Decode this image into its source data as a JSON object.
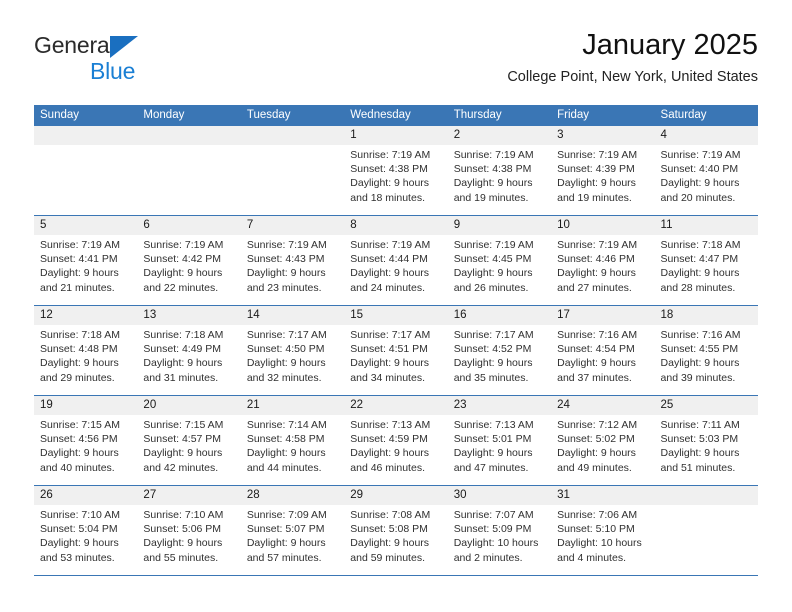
{
  "brand": {
    "name_top": "General",
    "name_bottom": "Blue",
    "accent_color": "#1a7fd4",
    "triangle_color": "#1a6fc0"
  },
  "header": {
    "title": "January 2025",
    "subtitle": "College Point, New York, United States"
  },
  "theme": {
    "header_bar_color": "#3a76b5",
    "day_band_color": "#f0f0f0",
    "row_rule_color": "#3a76b5"
  },
  "weekdays": [
    "Sunday",
    "Monday",
    "Tuesday",
    "Wednesday",
    "Thursday",
    "Friday",
    "Saturday"
  ],
  "labels": {
    "sunrise_prefix": "Sunrise:",
    "sunset_prefix": "Sunset:",
    "daylight_prefix": "Daylight:"
  },
  "weeks": [
    [
      {
        "day": "",
        "sunrise": "",
        "sunset": "",
        "daylight_line1": "",
        "daylight_line2": "",
        "empty": true
      },
      {
        "day": "",
        "sunrise": "",
        "sunset": "",
        "daylight_line1": "",
        "daylight_line2": "",
        "empty": true
      },
      {
        "day": "",
        "sunrise": "",
        "sunset": "",
        "daylight_line1": "",
        "daylight_line2": "",
        "empty": true
      },
      {
        "day": "1",
        "sunrise": "Sunrise: 7:19 AM",
        "sunset": "Sunset: 4:38 PM",
        "daylight_line1": "Daylight: 9 hours",
        "daylight_line2": "and 18 minutes.",
        "empty": false
      },
      {
        "day": "2",
        "sunrise": "Sunrise: 7:19 AM",
        "sunset": "Sunset: 4:38 PM",
        "daylight_line1": "Daylight: 9 hours",
        "daylight_line2": "and 19 minutes.",
        "empty": false
      },
      {
        "day": "3",
        "sunrise": "Sunrise: 7:19 AM",
        "sunset": "Sunset: 4:39 PM",
        "daylight_line1": "Daylight: 9 hours",
        "daylight_line2": "and 19 minutes.",
        "empty": false
      },
      {
        "day": "4",
        "sunrise": "Sunrise: 7:19 AM",
        "sunset": "Sunset: 4:40 PM",
        "daylight_line1": "Daylight: 9 hours",
        "daylight_line2": "and 20 minutes.",
        "empty": false
      }
    ],
    [
      {
        "day": "5",
        "sunrise": "Sunrise: 7:19 AM",
        "sunset": "Sunset: 4:41 PM",
        "daylight_line1": "Daylight: 9 hours",
        "daylight_line2": "and 21 minutes.",
        "empty": false
      },
      {
        "day": "6",
        "sunrise": "Sunrise: 7:19 AM",
        "sunset": "Sunset: 4:42 PM",
        "daylight_line1": "Daylight: 9 hours",
        "daylight_line2": "and 22 minutes.",
        "empty": false
      },
      {
        "day": "7",
        "sunrise": "Sunrise: 7:19 AM",
        "sunset": "Sunset: 4:43 PM",
        "daylight_line1": "Daylight: 9 hours",
        "daylight_line2": "and 23 minutes.",
        "empty": false
      },
      {
        "day": "8",
        "sunrise": "Sunrise: 7:19 AM",
        "sunset": "Sunset: 4:44 PM",
        "daylight_line1": "Daylight: 9 hours",
        "daylight_line2": "and 24 minutes.",
        "empty": false
      },
      {
        "day": "9",
        "sunrise": "Sunrise: 7:19 AM",
        "sunset": "Sunset: 4:45 PM",
        "daylight_line1": "Daylight: 9 hours",
        "daylight_line2": "and 26 minutes.",
        "empty": false
      },
      {
        "day": "10",
        "sunrise": "Sunrise: 7:19 AM",
        "sunset": "Sunset: 4:46 PM",
        "daylight_line1": "Daylight: 9 hours",
        "daylight_line2": "and 27 minutes.",
        "empty": false
      },
      {
        "day": "11",
        "sunrise": "Sunrise: 7:18 AM",
        "sunset": "Sunset: 4:47 PM",
        "daylight_line1": "Daylight: 9 hours",
        "daylight_line2": "and 28 minutes.",
        "empty": false
      }
    ],
    [
      {
        "day": "12",
        "sunrise": "Sunrise: 7:18 AM",
        "sunset": "Sunset: 4:48 PM",
        "daylight_line1": "Daylight: 9 hours",
        "daylight_line2": "and 29 minutes.",
        "empty": false
      },
      {
        "day": "13",
        "sunrise": "Sunrise: 7:18 AM",
        "sunset": "Sunset: 4:49 PM",
        "daylight_line1": "Daylight: 9 hours",
        "daylight_line2": "and 31 minutes.",
        "empty": false
      },
      {
        "day": "14",
        "sunrise": "Sunrise: 7:17 AM",
        "sunset": "Sunset: 4:50 PM",
        "daylight_line1": "Daylight: 9 hours",
        "daylight_line2": "and 32 minutes.",
        "empty": false
      },
      {
        "day": "15",
        "sunrise": "Sunrise: 7:17 AM",
        "sunset": "Sunset: 4:51 PM",
        "daylight_line1": "Daylight: 9 hours",
        "daylight_line2": "and 34 minutes.",
        "empty": false
      },
      {
        "day": "16",
        "sunrise": "Sunrise: 7:17 AM",
        "sunset": "Sunset: 4:52 PM",
        "daylight_line1": "Daylight: 9 hours",
        "daylight_line2": "and 35 minutes.",
        "empty": false
      },
      {
        "day": "17",
        "sunrise": "Sunrise: 7:16 AM",
        "sunset": "Sunset: 4:54 PM",
        "daylight_line1": "Daylight: 9 hours",
        "daylight_line2": "and 37 minutes.",
        "empty": false
      },
      {
        "day": "18",
        "sunrise": "Sunrise: 7:16 AM",
        "sunset": "Sunset: 4:55 PM",
        "daylight_line1": "Daylight: 9 hours",
        "daylight_line2": "and 39 minutes.",
        "empty": false
      }
    ],
    [
      {
        "day": "19",
        "sunrise": "Sunrise: 7:15 AM",
        "sunset": "Sunset: 4:56 PM",
        "daylight_line1": "Daylight: 9 hours",
        "daylight_line2": "and 40 minutes.",
        "empty": false
      },
      {
        "day": "20",
        "sunrise": "Sunrise: 7:15 AM",
        "sunset": "Sunset: 4:57 PM",
        "daylight_line1": "Daylight: 9 hours",
        "daylight_line2": "and 42 minutes.",
        "empty": false
      },
      {
        "day": "21",
        "sunrise": "Sunrise: 7:14 AM",
        "sunset": "Sunset: 4:58 PM",
        "daylight_line1": "Daylight: 9 hours",
        "daylight_line2": "and 44 minutes.",
        "empty": false
      },
      {
        "day": "22",
        "sunrise": "Sunrise: 7:13 AM",
        "sunset": "Sunset: 4:59 PM",
        "daylight_line1": "Daylight: 9 hours",
        "daylight_line2": "and 46 minutes.",
        "empty": false
      },
      {
        "day": "23",
        "sunrise": "Sunrise: 7:13 AM",
        "sunset": "Sunset: 5:01 PM",
        "daylight_line1": "Daylight: 9 hours",
        "daylight_line2": "and 47 minutes.",
        "empty": false
      },
      {
        "day": "24",
        "sunrise": "Sunrise: 7:12 AM",
        "sunset": "Sunset: 5:02 PM",
        "daylight_line1": "Daylight: 9 hours",
        "daylight_line2": "and 49 minutes.",
        "empty": false
      },
      {
        "day": "25",
        "sunrise": "Sunrise: 7:11 AM",
        "sunset": "Sunset: 5:03 PM",
        "daylight_line1": "Daylight: 9 hours",
        "daylight_line2": "and 51 minutes.",
        "empty": false
      }
    ],
    [
      {
        "day": "26",
        "sunrise": "Sunrise: 7:10 AM",
        "sunset": "Sunset: 5:04 PM",
        "daylight_line1": "Daylight: 9 hours",
        "daylight_line2": "and 53 minutes.",
        "empty": false
      },
      {
        "day": "27",
        "sunrise": "Sunrise: 7:10 AM",
        "sunset": "Sunset: 5:06 PM",
        "daylight_line1": "Daylight: 9 hours",
        "daylight_line2": "and 55 minutes.",
        "empty": false
      },
      {
        "day": "28",
        "sunrise": "Sunrise: 7:09 AM",
        "sunset": "Sunset: 5:07 PM",
        "daylight_line1": "Daylight: 9 hours",
        "daylight_line2": "and 57 minutes.",
        "empty": false
      },
      {
        "day": "29",
        "sunrise": "Sunrise: 7:08 AM",
        "sunset": "Sunset: 5:08 PM",
        "daylight_line1": "Daylight: 9 hours",
        "daylight_line2": "and 59 minutes.",
        "empty": false
      },
      {
        "day": "30",
        "sunrise": "Sunrise: 7:07 AM",
        "sunset": "Sunset: 5:09 PM",
        "daylight_line1": "Daylight: 10 hours",
        "daylight_line2": "and 2 minutes.",
        "empty": false
      },
      {
        "day": "31",
        "sunrise": "Sunrise: 7:06 AM",
        "sunset": "Sunset: 5:10 PM",
        "daylight_line1": "Daylight: 10 hours",
        "daylight_line2": "and 4 minutes.",
        "empty": false
      },
      {
        "day": "",
        "sunrise": "",
        "sunset": "",
        "daylight_line1": "",
        "daylight_line2": "",
        "empty": true
      }
    ]
  ]
}
